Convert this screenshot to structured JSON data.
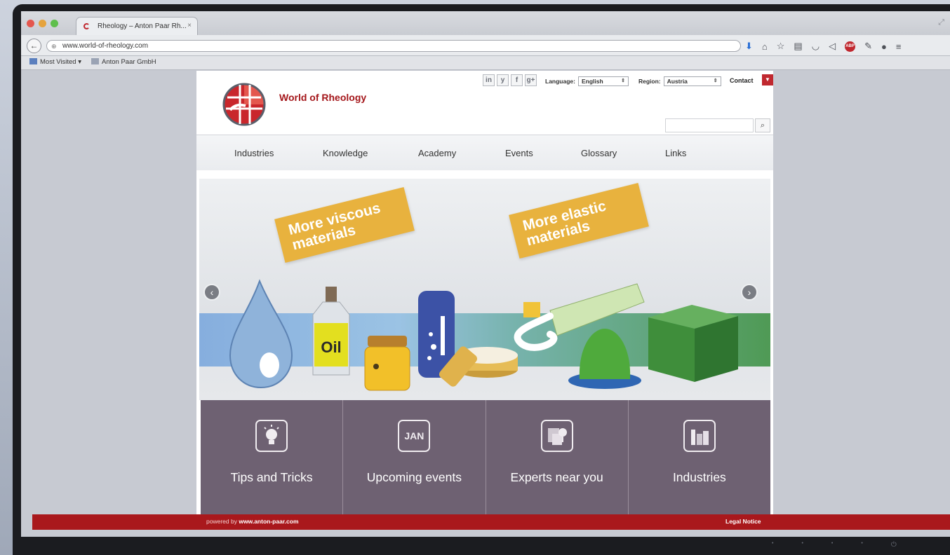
{
  "browser": {
    "tab_title": "Rheology – Anton Paar Rh...",
    "tab_close": "×",
    "url": "www.world-of-rheology.com",
    "bookmarks": [
      "Most Visited ▾",
      "Anton Paar GmbH"
    ],
    "traffic_light_colors": [
      "#e4574e",
      "#e5a33d",
      "#5fbf4d"
    ]
  },
  "site": {
    "name": "World of Rheology",
    "social": [
      "in",
      "y",
      "f",
      "g+"
    ],
    "language_label": "Language:",
    "language_value": "English",
    "region_label": "Region:",
    "region_value": "Austria",
    "contact": "Contact",
    "search_placeholder": ""
  },
  "nav": [
    "Industries",
    "Knowledge",
    "Academy",
    "Events",
    "Glossary",
    "Links"
  ],
  "hero": {
    "tag_left": "More viscous materials",
    "tag_right": "More elastic materials",
    "oil_label": "Oil",
    "prev": "‹",
    "next": "›"
  },
  "features": [
    {
      "label": "Tips and Tricks",
      "icon": "lightbulb-icon"
    },
    {
      "label": "Upcoming events",
      "icon": "calendar-icon",
      "icon_text": "JAN"
    },
    {
      "label": "Experts near you",
      "icon": "map-pin-icon"
    },
    {
      "label": "Industries",
      "icon": "factory-icon"
    }
  ],
  "footer": {
    "powered_prefix": "powered by",
    "powered_link": "www.anton-paar.com",
    "legal": "Legal Notice"
  },
  "colors": {
    "brand_red": "#a9181c",
    "feature_bg": "#6e6172",
    "tag_orange": "#e8b23e"
  }
}
